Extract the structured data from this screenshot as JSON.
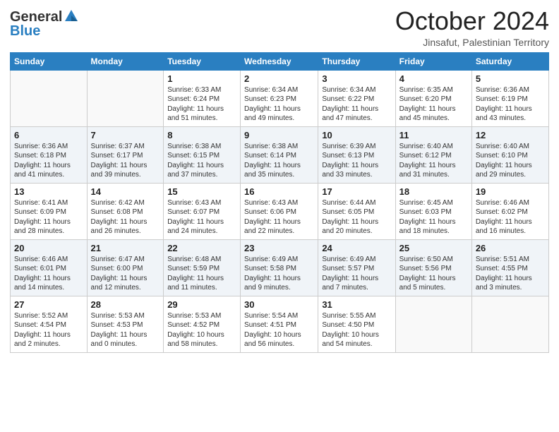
{
  "header": {
    "logo_general": "General",
    "logo_blue": "Blue",
    "title": "October 2024",
    "location": "Jinsafut, Palestinian Territory"
  },
  "days_of_week": [
    "Sunday",
    "Monday",
    "Tuesday",
    "Wednesday",
    "Thursday",
    "Friday",
    "Saturday"
  ],
  "weeks": [
    [
      {
        "day": "",
        "sunrise": "",
        "sunset": "",
        "daylight": ""
      },
      {
        "day": "",
        "sunrise": "",
        "sunset": "",
        "daylight": ""
      },
      {
        "day": "1",
        "sunrise": "Sunrise: 6:33 AM",
        "sunset": "Sunset: 6:24 PM",
        "daylight": "Daylight: 11 hours and 51 minutes."
      },
      {
        "day": "2",
        "sunrise": "Sunrise: 6:34 AM",
        "sunset": "Sunset: 6:23 PM",
        "daylight": "Daylight: 11 hours and 49 minutes."
      },
      {
        "day": "3",
        "sunrise": "Sunrise: 6:34 AM",
        "sunset": "Sunset: 6:22 PM",
        "daylight": "Daylight: 11 hours and 47 minutes."
      },
      {
        "day": "4",
        "sunrise": "Sunrise: 6:35 AM",
        "sunset": "Sunset: 6:20 PM",
        "daylight": "Daylight: 11 hours and 45 minutes."
      },
      {
        "day": "5",
        "sunrise": "Sunrise: 6:36 AM",
        "sunset": "Sunset: 6:19 PM",
        "daylight": "Daylight: 11 hours and 43 minutes."
      }
    ],
    [
      {
        "day": "6",
        "sunrise": "Sunrise: 6:36 AM",
        "sunset": "Sunset: 6:18 PM",
        "daylight": "Daylight: 11 hours and 41 minutes."
      },
      {
        "day": "7",
        "sunrise": "Sunrise: 6:37 AM",
        "sunset": "Sunset: 6:17 PM",
        "daylight": "Daylight: 11 hours and 39 minutes."
      },
      {
        "day": "8",
        "sunrise": "Sunrise: 6:38 AM",
        "sunset": "Sunset: 6:15 PM",
        "daylight": "Daylight: 11 hours and 37 minutes."
      },
      {
        "day": "9",
        "sunrise": "Sunrise: 6:38 AM",
        "sunset": "Sunset: 6:14 PM",
        "daylight": "Daylight: 11 hours and 35 minutes."
      },
      {
        "day": "10",
        "sunrise": "Sunrise: 6:39 AM",
        "sunset": "Sunset: 6:13 PM",
        "daylight": "Daylight: 11 hours and 33 minutes."
      },
      {
        "day": "11",
        "sunrise": "Sunrise: 6:40 AM",
        "sunset": "Sunset: 6:12 PM",
        "daylight": "Daylight: 11 hours and 31 minutes."
      },
      {
        "day": "12",
        "sunrise": "Sunrise: 6:40 AM",
        "sunset": "Sunset: 6:10 PM",
        "daylight": "Daylight: 11 hours and 29 minutes."
      }
    ],
    [
      {
        "day": "13",
        "sunrise": "Sunrise: 6:41 AM",
        "sunset": "Sunset: 6:09 PM",
        "daylight": "Daylight: 11 hours and 28 minutes."
      },
      {
        "day": "14",
        "sunrise": "Sunrise: 6:42 AM",
        "sunset": "Sunset: 6:08 PM",
        "daylight": "Daylight: 11 hours and 26 minutes."
      },
      {
        "day": "15",
        "sunrise": "Sunrise: 6:43 AM",
        "sunset": "Sunset: 6:07 PM",
        "daylight": "Daylight: 11 hours and 24 minutes."
      },
      {
        "day": "16",
        "sunrise": "Sunrise: 6:43 AM",
        "sunset": "Sunset: 6:06 PM",
        "daylight": "Daylight: 11 hours and 22 minutes."
      },
      {
        "day": "17",
        "sunrise": "Sunrise: 6:44 AM",
        "sunset": "Sunset: 6:05 PM",
        "daylight": "Daylight: 11 hours and 20 minutes."
      },
      {
        "day": "18",
        "sunrise": "Sunrise: 6:45 AM",
        "sunset": "Sunset: 6:03 PM",
        "daylight": "Daylight: 11 hours and 18 minutes."
      },
      {
        "day": "19",
        "sunrise": "Sunrise: 6:46 AM",
        "sunset": "Sunset: 6:02 PM",
        "daylight": "Daylight: 11 hours and 16 minutes."
      }
    ],
    [
      {
        "day": "20",
        "sunrise": "Sunrise: 6:46 AM",
        "sunset": "Sunset: 6:01 PM",
        "daylight": "Daylight: 11 hours and 14 minutes."
      },
      {
        "day": "21",
        "sunrise": "Sunrise: 6:47 AM",
        "sunset": "Sunset: 6:00 PM",
        "daylight": "Daylight: 11 hours and 12 minutes."
      },
      {
        "day": "22",
        "sunrise": "Sunrise: 6:48 AM",
        "sunset": "Sunset: 5:59 PM",
        "daylight": "Daylight: 11 hours and 11 minutes."
      },
      {
        "day": "23",
        "sunrise": "Sunrise: 6:49 AM",
        "sunset": "Sunset: 5:58 PM",
        "daylight": "Daylight: 11 hours and 9 minutes."
      },
      {
        "day": "24",
        "sunrise": "Sunrise: 6:49 AM",
        "sunset": "Sunset: 5:57 PM",
        "daylight": "Daylight: 11 hours and 7 minutes."
      },
      {
        "day": "25",
        "sunrise": "Sunrise: 6:50 AM",
        "sunset": "Sunset: 5:56 PM",
        "daylight": "Daylight: 11 hours and 5 minutes."
      },
      {
        "day": "26",
        "sunrise": "Sunrise: 5:51 AM",
        "sunset": "Sunset: 4:55 PM",
        "daylight": "Daylight: 11 hours and 3 minutes."
      }
    ],
    [
      {
        "day": "27",
        "sunrise": "Sunrise: 5:52 AM",
        "sunset": "Sunset: 4:54 PM",
        "daylight": "Daylight: 11 hours and 2 minutes."
      },
      {
        "day": "28",
        "sunrise": "Sunrise: 5:53 AM",
        "sunset": "Sunset: 4:53 PM",
        "daylight": "Daylight: 11 hours and 0 minutes."
      },
      {
        "day": "29",
        "sunrise": "Sunrise: 5:53 AM",
        "sunset": "Sunset: 4:52 PM",
        "daylight": "Daylight: 10 hours and 58 minutes."
      },
      {
        "day": "30",
        "sunrise": "Sunrise: 5:54 AM",
        "sunset": "Sunset: 4:51 PM",
        "daylight": "Daylight: 10 hours and 56 minutes."
      },
      {
        "day": "31",
        "sunrise": "Sunrise: 5:55 AM",
        "sunset": "Sunset: 4:50 PM",
        "daylight": "Daylight: 10 hours and 54 minutes."
      },
      {
        "day": "",
        "sunrise": "",
        "sunset": "",
        "daylight": ""
      },
      {
        "day": "",
        "sunrise": "",
        "sunset": "",
        "daylight": ""
      }
    ]
  ]
}
